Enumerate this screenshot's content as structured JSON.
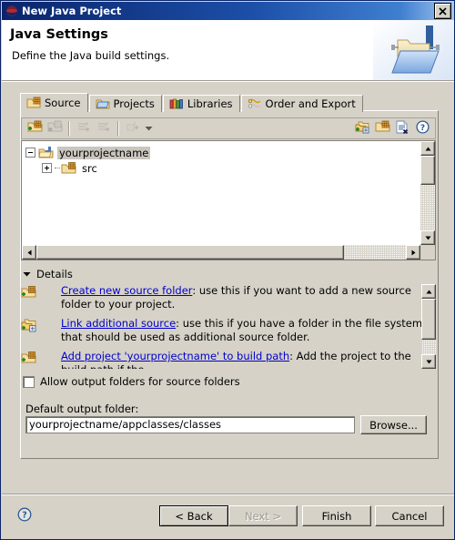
{
  "window": {
    "title": "New Java Project",
    "icon": "java-project-icon",
    "close_label": "close-window"
  },
  "header": {
    "title": "Java Settings",
    "subtitle": "Define the Java build settings.",
    "banner_icon": "java-folder-banner-icon"
  },
  "tabs": [
    {
      "label": "Source",
      "icon": "source-folder-icon",
      "active": true
    },
    {
      "label": "Projects",
      "icon": "projects-folder-icon",
      "active": false
    },
    {
      "label": "Libraries",
      "icon": "libraries-books-icon",
      "active": false
    },
    {
      "label": "Order and Export",
      "icon": "order-export-icon",
      "active": false
    }
  ],
  "toolbar": {
    "buttons": [
      {
        "name": "add-folder-button",
        "icon": "add-source-folder-icon",
        "enabled": true
      },
      {
        "name": "remove-folder-button",
        "icon": "remove-source-folder-icon",
        "enabled": false
      },
      {
        "name": "add-inclusion-button",
        "icon": "add-inclusion-icon",
        "enabled": false
      },
      {
        "name": "add-exclusion-button",
        "icon": "add-exclusion-icon",
        "enabled": false
      },
      {
        "name": "configure-button",
        "icon": "configure-filters-icon",
        "enabled": false
      }
    ],
    "dropdown_label": "toolbar-dropdown-arrow",
    "right_buttons": [
      {
        "name": "link-source-button",
        "icon": "link-additional-source-icon",
        "enabled": true
      },
      {
        "name": "create-folder-button",
        "icon": "create-new-source-folder-icon",
        "enabled": true
      },
      {
        "name": "edit-filters-button",
        "icon": "edit-filters-icon",
        "enabled": true
      },
      {
        "name": "help-button",
        "icon": "help-question-icon",
        "enabled": true
      }
    ]
  },
  "tree": {
    "nodes": [
      {
        "label": "yourprojectname",
        "icon": "project-folder-icon",
        "expanded": true,
        "selected": true,
        "level": 0
      },
      {
        "label": "src",
        "icon": "source-folder-icon",
        "expanded": false,
        "selected": false,
        "level": 1
      }
    ]
  },
  "details": {
    "header_label": "Details",
    "expanded": true,
    "items": [
      {
        "icon": "create-new-source-folder-icon",
        "link": "Create new source folder",
        "text": ": use this if you want to add a new source folder to your project."
      },
      {
        "icon": "link-additional-source-icon",
        "link": "Link additional source",
        "text": ": use this if you have a folder in the file system that should be used as additional source folder."
      },
      {
        "icon": "add-project-to-build-path-icon",
        "link": "Add project 'yourprojectname' to build path",
        "text": ": Add the project to the build path if the"
      }
    ]
  },
  "options": {
    "allow_output_folders_label": "Allow output folders for source folders",
    "allow_output_folders_checked": false
  },
  "output": {
    "label": "Default output folder:",
    "value": "yourprojectname/appclasses/classes",
    "placeholder": "",
    "browse_label": "Browse..."
  },
  "footer": {
    "help_icon": "help-question-icon",
    "buttons": [
      {
        "label": "< Back",
        "name": "back-button",
        "enabled": true,
        "default": true
      },
      {
        "label": "Next >",
        "name": "next-button",
        "enabled": false,
        "default": false
      },
      {
        "label": "Finish",
        "name": "finish-button",
        "enabled": true,
        "default": false
      },
      {
        "label": "Cancel",
        "name": "cancel-button",
        "enabled": true,
        "default": false
      }
    ]
  },
  "colors": {
    "title_bar_start": "#0a246a",
    "dialog_face": "#d6d2c8",
    "link": "#0000cc",
    "field_bg": "#ffffff"
  }
}
